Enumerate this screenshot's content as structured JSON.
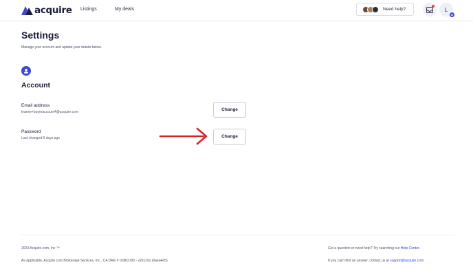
{
  "header": {
    "logo_text": "acquire",
    "nav": [
      {
        "label": "Listings"
      },
      {
        "label": "My deals"
      }
    ],
    "help_label": "Need help?",
    "user_initial": "L",
    "user_badge": "W"
  },
  "page": {
    "title": "Settings",
    "subtitle": "Manage your account and update your details below."
  },
  "account": {
    "title": "Account",
    "email": {
      "label": "Email address",
      "value": "leanne+buyeraccount4@acquire.com",
      "button": "Change"
    },
    "password": {
      "label": "Password",
      "value": "Last changed 8 days ago",
      "button": "Change"
    }
  },
  "footer": {
    "copyright": "2023 Acquire.com, Inc ™",
    "legal": "As applicable, Acquire.com Brokerage Services, Inc., CA DRE # 01862195 - v29.0.0s (0aea4d5)",
    "question_prefix": "Got a question or need help? Try searching our ",
    "help_center_link": "Help Center",
    "question_suffix": ".",
    "contact_prefix": "If you can't find an answer, contact us at ",
    "support_email": "support@acquire.com"
  },
  "colors": {
    "accent": "#3a49d0",
    "link": "#2f45d6",
    "annotation_arrow": "#d6232a",
    "notification_dot": "#e0463d"
  },
  "icons": {
    "logo": "acquire-logo-icon",
    "inbox": "inbox-icon",
    "section": "user-icon",
    "annotation": "arrow-right-icon"
  }
}
